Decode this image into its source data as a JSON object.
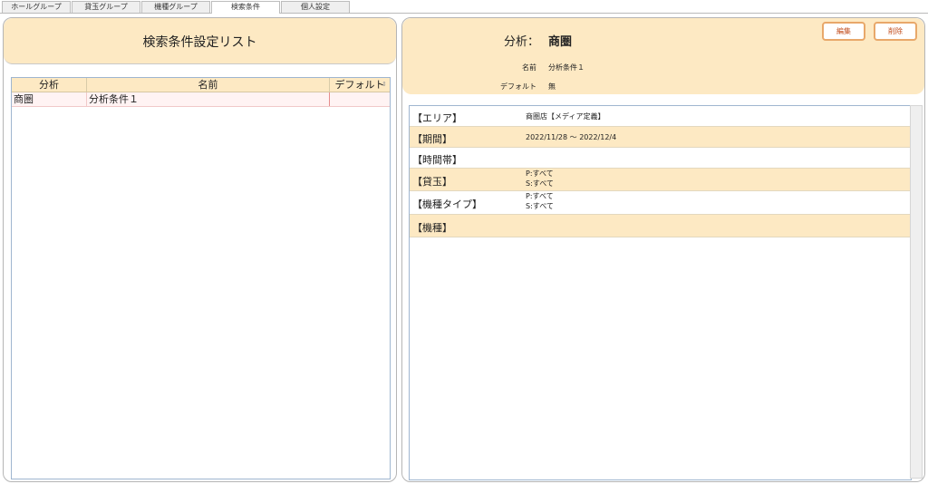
{
  "tabs": [
    {
      "label": "ホールグループ"
    },
    {
      "label": "貸玉グループ"
    },
    {
      "label": "機種グループ"
    },
    {
      "label": "検索条件"
    },
    {
      "label": "個人設定"
    }
  ],
  "left": {
    "title": "検索条件設定リスト",
    "columns": [
      "分析",
      "名前",
      "デフォルト"
    ],
    "rows": [
      {
        "bunseki": "商圏",
        "name": "分析条件１",
        "default": ""
      }
    ]
  },
  "right": {
    "bunseki_label": "分析：",
    "bunseki_value": "商圏",
    "name_label": "名前",
    "name_value": "分析条件１",
    "default_label": "デフォルト",
    "default_value": "無",
    "edit_label": "編集",
    "delete_label": "削除",
    "details": [
      {
        "label": "【エリア】",
        "lines": [
          "商圏店【メディア定義】"
        ]
      },
      {
        "label": "【期間】",
        "lines": [
          "2022/11/28 ～ 2022/12/4"
        ]
      },
      {
        "label": "【時間帯】",
        "lines": [
          ""
        ]
      },
      {
        "label": "【貸玉】",
        "lines": [
          "P:すべて",
          "S:すべて"
        ]
      },
      {
        "label": "【機種タイプ】",
        "lines": [
          "P:すべて",
          "S:すべて"
        ]
      },
      {
        "label": "【機種】",
        "lines": [
          ""
        ]
      }
    ]
  },
  "colors": {
    "header_bg": "#fde9c3",
    "button_text": "#c24d1c",
    "button_border": "#e8a86a"
  }
}
